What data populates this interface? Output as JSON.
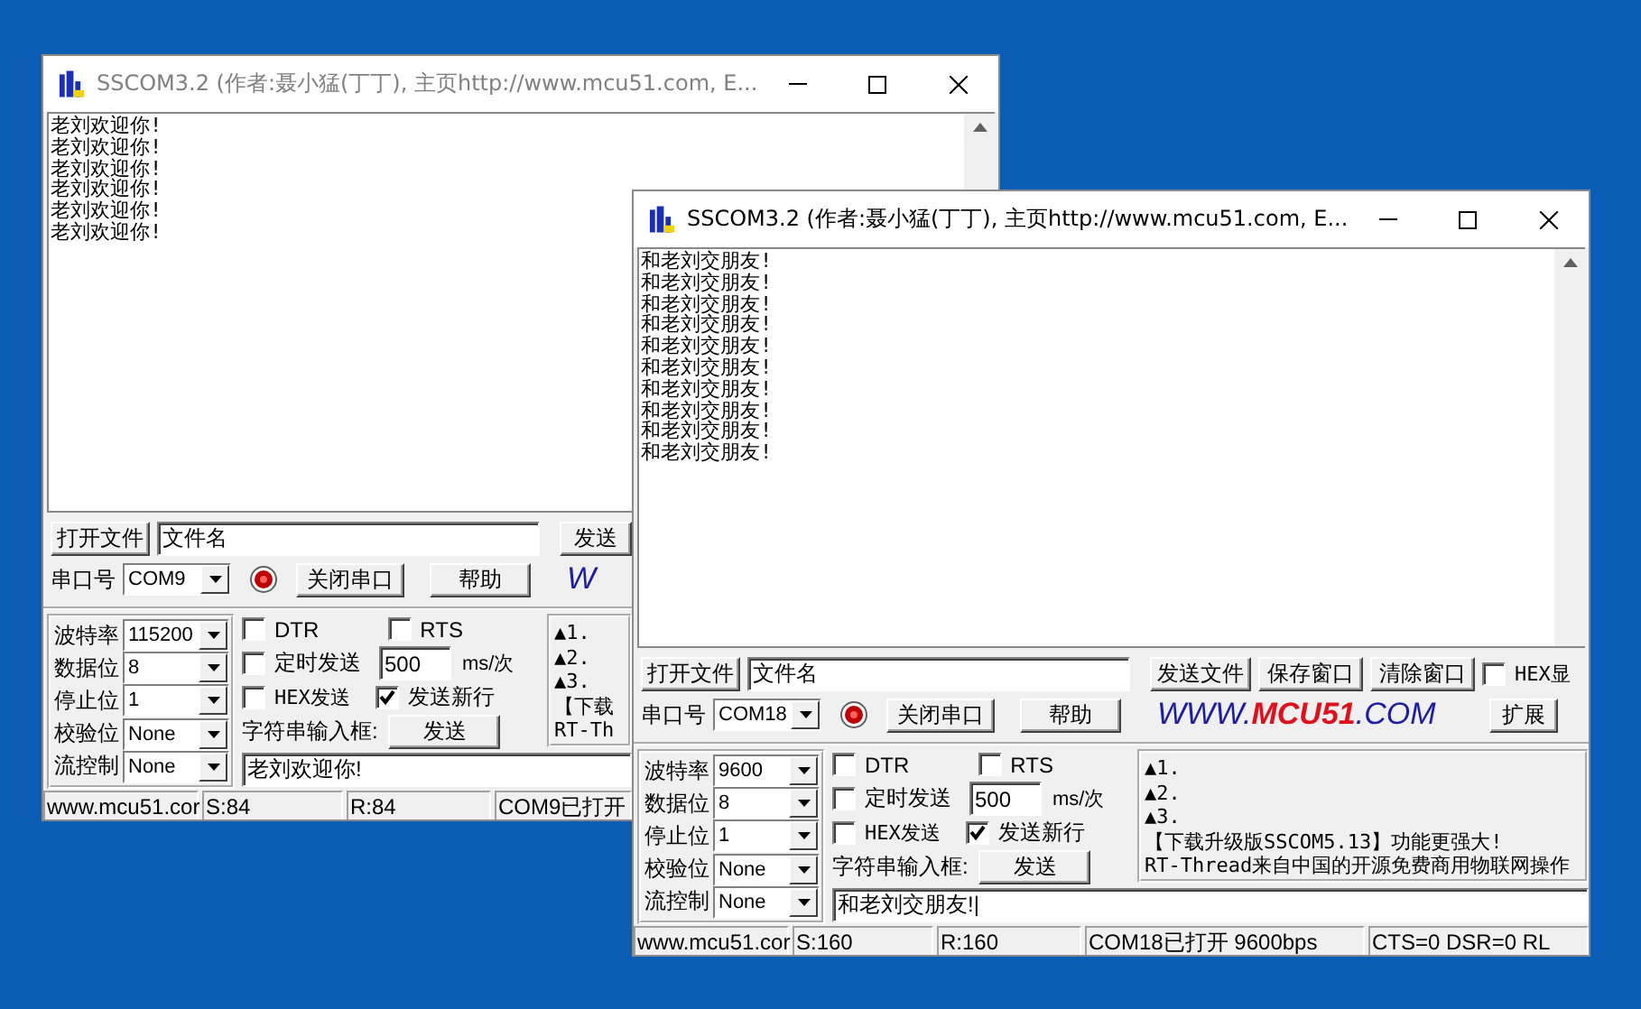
{
  "windows": [
    {
      "title": "SSCOM3.2 (作者:聂小猛(丁丁), 主页http://www.mcu51.com,  E...",
      "active": false,
      "output_lines": [
        "老刘欢迎你!",
        "老刘欢迎你!",
        "老刘欢迎你!",
        "老刘欢迎你!",
        "老刘欢迎你!",
        "老刘欢迎你!"
      ],
      "open_file_button": "打开文件",
      "file_name": "文件名",
      "file_buttons": [
        "发送"
      ],
      "port_label": "串口号",
      "port": "COM9",
      "port_open": true,
      "close_port_button": "关闭串口",
      "help_button": "帮助",
      "logo": [
        "W"
      ],
      "settings": [
        {
          "label": "波特率",
          "value": "115200"
        },
        {
          "label": "数据位",
          "value": "8"
        },
        {
          "label": "停止位",
          "value": "1"
        },
        {
          "label": "校验位",
          "value": "None"
        },
        {
          "label": "流控制",
          "value": "None"
        }
      ],
      "dtr": {
        "label": "DTR",
        "checked": false
      },
      "rts": {
        "label": "RTS",
        "checked": false
      },
      "timed_send": {
        "label": "定时发送",
        "checked": false
      },
      "interval": "500",
      "interval_unit": "ms/次",
      "hex_send": {
        "label": "HEX发送",
        "checked": false
      },
      "newline": {
        "label": "发送新行",
        "checked": true
      },
      "input_label": "字符串输入框:",
      "send_button": "发送",
      "input_value": "老刘欢迎你!",
      "info_lines": [
        "▲1.",
        "▲2.",
        "▲3.",
        "【下载",
        "RT-Th"
      ],
      "status": [
        "www.mcu51.cor",
        "S:84",
        "R:84",
        "COM9已打开"
      ]
    },
    {
      "title": "SSCOM3.2 (作者:聂小猛(丁丁), 主页http://www.mcu51.com,  E...",
      "active": true,
      "output_lines": [
        "和老刘交朋友!",
        "和老刘交朋友!",
        "和老刘交朋友!",
        "和老刘交朋友!",
        "和老刘交朋友!",
        "和老刘交朋友!",
        "和老刘交朋友!",
        "和老刘交朋友!",
        "和老刘交朋友!",
        "和老刘交朋友!"
      ],
      "open_file_button": "打开文件",
      "file_name": "文件名",
      "file_buttons": [
        "发送文件",
        "保存窗口",
        "清除窗口"
      ],
      "hex_display": {
        "label": "HEX显",
        "checked": false
      },
      "port_label": "串口号",
      "port": "COM18",
      "port_open": true,
      "close_port_button": "关闭串口",
      "help_button": "帮助",
      "logo": [
        "WWW.",
        "MCU51",
        ".COM"
      ],
      "expand_button": "扩展",
      "settings": [
        {
          "label": "波特率",
          "value": "9600"
        },
        {
          "label": "数据位",
          "value": "8"
        },
        {
          "label": "停止位",
          "value": "1"
        },
        {
          "label": "校验位",
          "value": "None"
        },
        {
          "label": "流控制",
          "value": "None"
        }
      ],
      "dtr": {
        "label": "DTR",
        "checked": false
      },
      "rts": {
        "label": "RTS",
        "checked": false
      },
      "timed_send": {
        "label": "定时发送",
        "checked": false
      },
      "interval": "500",
      "interval_unit": "ms/次",
      "hex_send": {
        "label": "HEX发送",
        "checked": false
      },
      "newline": {
        "label": "发送新行",
        "checked": true
      },
      "input_label": "字符串输入框:",
      "send_button": "发送",
      "input_value": "和老刘交朋友!|",
      "info_lines": [
        "▲1.",
        "▲2.",
        "▲3.",
        "【下载升级版SSCOM5.13】功能更强大!",
        "RT-Thread来自中国的开源免费商用物联网操作"
      ],
      "status": [
        "www.mcu51.cor",
        "S:160",
        "R:160",
        "COM18已打开  9600bps",
        "CTS=0 DSR=0 RL"
      ]
    }
  ]
}
